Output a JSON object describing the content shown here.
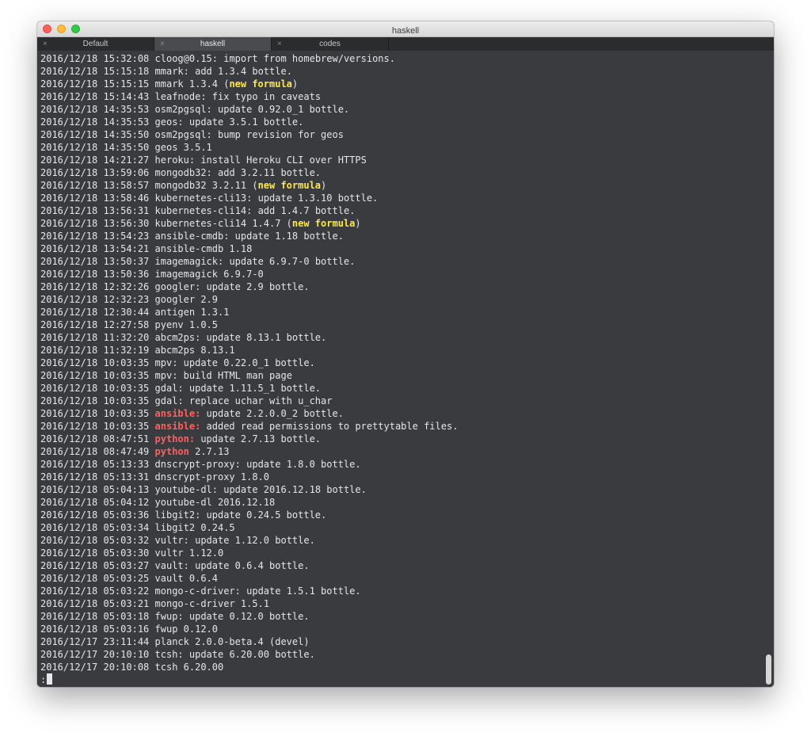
{
  "window": {
    "title": "haskell"
  },
  "tabs": [
    {
      "label": "Default",
      "close": "×",
      "active": false
    },
    {
      "label": "haskell",
      "close": "×",
      "active": true
    },
    {
      "label": "codes",
      "close": "×",
      "active": false
    }
  ],
  "colors": {
    "background": "#3a3b3f",
    "text": "#e6e6e6",
    "new_formula": "#ffe84a",
    "highlight_red": "#ff5f5f"
  },
  "lines": [
    {
      "ts": "2016/12/18 15:32:08",
      "pkg": "cloog@0.15:",
      "pkg_style": "",
      "rest": " import from homebrew/versions."
    },
    {
      "ts": "2016/12/18 15:15:18",
      "pkg": "mmark:",
      "pkg_style": "",
      "rest": " add 1.3.4 bottle."
    },
    {
      "ts": "2016/12/18 15:15:15",
      "pkg": "mmark 1.3.4 (",
      "pkg_style": "",
      "badge": "new formula",
      "rest": ")"
    },
    {
      "ts": "2016/12/18 15:14:43",
      "pkg": "leafnode:",
      "pkg_style": "",
      "rest": " fix typo in caveats"
    },
    {
      "ts": "2016/12/18 14:35:53",
      "pkg": "osm2pgsql:",
      "pkg_style": "",
      "rest": " update 0.92.0_1 bottle."
    },
    {
      "ts": "2016/12/18 14:35:53",
      "pkg": "geos:",
      "pkg_style": "",
      "rest": " update 3.5.1 bottle."
    },
    {
      "ts": "2016/12/18 14:35:50",
      "pkg": "osm2pgsql:",
      "pkg_style": "",
      "rest": " bump revision for geos"
    },
    {
      "ts": "2016/12/18 14:35:50",
      "pkg": "geos 3.5.1",
      "pkg_style": "",
      "rest": ""
    },
    {
      "ts": "2016/12/18 14:21:27",
      "pkg": "heroku:",
      "pkg_style": "",
      "rest": " install Heroku CLI over HTTPS"
    },
    {
      "ts": "2016/12/18 13:59:06",
      "pkg": "mongodb32:",
      "pkg_style": "",
      "rest": " add 3.2.11 bottle."
    },
    {
      "ts": "2016/12/18 13:58:57",
      "pkg": "mongodb32 3.2.11 (",
      "pkg_style": "",
      "badge": "new formula",
      "rest": ")"
    },
    {
      "ts": "2016/12/18 13:58:46",
      "pkg": "kubernetes-cli13:",
      "pkg_style": "",
      "rest": " update 1.3.10 bottle."
    },
    {
      "ts": "2016/12/18 13:56:31",
      "pkg": "kubernetes-cli14:",
      "pkg_style": "",
      "rest": " add 1.4.7 bottle."
    },
    {
      "ts": "2016/12/18 13:56:30",
      "pkg": "kubernetes-cli14 1.4.7 (",
      "pkg_style": "",
      "badge": "new formula",
      "rest": ")"
    },
    {
      "ts": "2016/12/18 13:54:23",
      "pkg": "ansible-cmdb:",
      "pkg_style": "",
      "rest": " update 1.18 bottle."
    },
    {
      "ts": "2016/12/18 13:54:21",
      "pkg": "ansible-cmdb 1.18",
      "pkg_style": "",
      "rest": ""
    },
    {
      "ts": "2016/12/18 13:50:37",
      "pkg": "imagemagick:",
      "pkg_style": "",
      "rest": " update 6.9.7-0 bottle."
    },
    {
      "ts": "2016/12/18 13:50:36",
      "pkg": "imagemagick 6.9.7-0",
      "pkg_style": "",
      "rest": ""
    },
    {
      "ts": "2016/12/18 12:32:26",
      "pkg": "googler:",
      "pkg_style": "",
      "rest": " update 2.9 bottle."
    },
    {
      "ts": "2016/12/18 12:32:23",
      "pkg": "googler 2.9",
      "pkg_style": "",
      "rest": ""
    },
    {
      "ts": "2016/12/18 12:30:44",
      "pkg": "antigen 1.3.1",
      "pkg_style": "",
      "rest": ""
    },
    {
      "ts": "2016/12/18 12:27:58",
      "pkg": "pyenv 1.0.5",
      "pkg_style": "",
      "rest": ""
    },
    {
      "ts": "2016/12/18 11:32:20",
      "pkg": "abcm2ps:",
      "pkg_style": "",
      "rest": " update 8.13.1 bottle."
    },
    {
      "ts": "2016/12/18 11:32:19",
      "pkg": "abcm2ps 8.13.1",
      "pkg_style": "",
      "rest": ""
    },
    {
      "ts": "2016/12/18 10:03:35",
      "pkg": "mpv:",
      "pkg_style": "",
      "rest": " update 0.22.0_1 bottle."
    },
    {
      "ts": "2016/12/18 10:03:35",
      "pkg": "mpv:",
      "pkg_style": "",
      "rest": " build HTML man page"
    },
    {
      "ts": "2016/12/18 10:03:35",
      "pkg": "gdal:",
      "pkg_style": "",
      "rest": " update 1.11.5_1 bottle."
    },
    {
      "ts": "2016/12/18 10:03:35",
      "pkg": "gdal:",
      "pkg_style": "",
      "rest": " replace uchar with u_char"
    },
    {
      "ts": "2016/12/18 10:03:35",
      "pkg": "ansible:",
      "pkg_style": "red",
      "rest": " update 2.2.0.0_2 bottle."
    },
    {
      "ts": "2016/12/18 10:03:35",
      "pkg": "ansible:",
      "pkg_style": "red",
      "rest": " added read permissions to prettytable files."
    },
    {
      "ts": "2016/12/18 08:47:51",
      "pkg": "python:",
      "pkg_style": "red",
      "rest": " update 2.7.13 bottle."
    },
    {
      "ts": "2016/12/18 08:47:49",
      "pkg": "python",
      "pkg_style": "red",
      "rest": " 2.7.13"
    },
    {
      "ts": "2016/12/18 05:13:33",
      "pkg": "dnscrypt-proxy:",
      "pkg_style": "",
      "rest": " update 1.8.0 bottle."
    },
    {
      "ts": "2016/12/18 05:13:31",
      "pkg": "dnscrypt-proxy 1.8.0",
      "pkg_style": "",
      "rest": ""
    },
    {
      "ts": "2016/12/18 05:04:13",
      "pkg": "youtube-dl:",
      "pkg_style": "",
      "rest": " update 2016.12.18 bottle."
    },
    {
      "ts": "2016/12/18 05:04:12",
      "pkg": "youtube-dl 2016.12.18",
      "pkg_style": "",
      "rest": ""
    },
    {
      "ts": "2016/12/18 05:03:36",
      "pkg": "libgit2:",
      "pkg_style": "",
      "rest": " update 0.24.5 bottle."
    },
    {
      "ts": "2016/12/18 05:03:34",
      "pkg": "libgit2 0.24.5",
      "pkg_style": "",
      "rest": ""
    },
    {
      "ts": "2016/12/18 05:03:32",
      "pkg": "vultr:",
      "pkg_style": "",
      "rest": " update 1.12.0 bottle."
    },
    {
      "ts": "2016/12/18 05:03:30",
      "pkg": "vultr 1.12.0",
      "pkg_style": "",
      "rest": ""
    },
    {
      "ts": "2016/12/18 05:03:27",
      "pkg": "vault:",
      "pkg_style": "",
      "rest": " update 0.6.4 bottle."
    },
    {
      "ts": "2016/12/18 05:03:25",
      "pkg": "vault 0.6.4",
      "pkg_style": "",
      "rest": ""
    },
    {
      "ts": "2016/12/18 05:03:22",
      "pkg": "mongo-c-driver:",
      "pkg_style": "",
      "rest": " update 1.5.1 bottle."
    },
    {
      "ts": "2016/12/18 05:03:21",
      "pkg": "mongo-c-driver 1.5.1",
      "pkg_style": "",
      "rest": ""
    },
    {
      "ts": "2016/12/18 05:03:18",
      "pkg": "fwup:",
      "pkg_style": "",
      "rest": " update 0.12.0 bottle."
    },
    {
      "ts": "2016/12/18 05:03:16",
      "pkg": "fwup 0.12.0",
      "pkg_style": "",
      "rest": ""
    },
    {
      "ts": "2016/12/17 23:11:44",
      "pkg": "planck 2.0.0-beta.4 (devel)",
      "pkg_style": "",
      "rest": ""
    },
    {
      "ts": "2016/12/17 20:10:10",
      "pkg": "tcsh:",
      "pkg_style": "",
      "rest": " update 6.20.00 bottle."
    },
    {
      "ts": "2016/12/17 20:10:08",
      "pkg": "tcsh 6.20.00",
      "pkg_style": "",
      "rest": ""
    }
  ],
  "prompt": ":"
}
